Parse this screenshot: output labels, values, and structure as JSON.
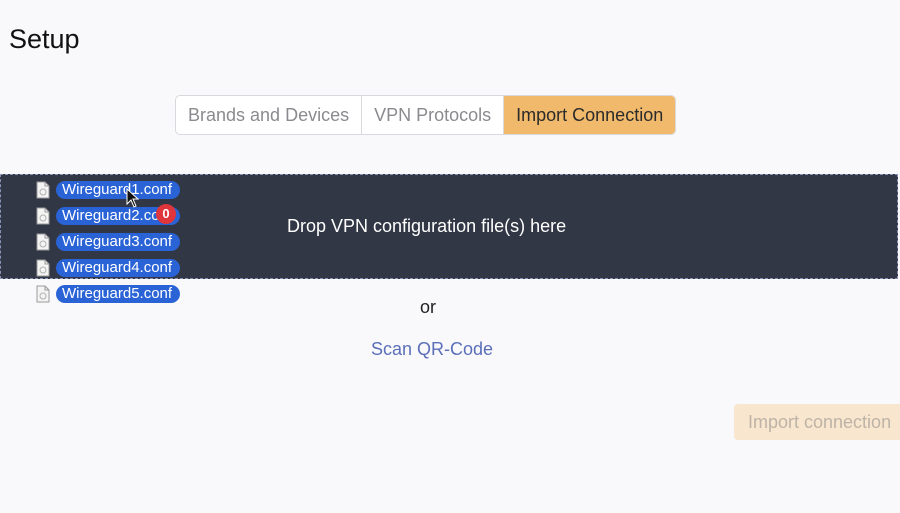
{
  "page": {
    "title": "Setup"
  },
  "tabs": [
    {
      "label": "Brands and Devices",
      "active": false
    },
    {
      "label": "VPN Protocols",
      "active": false
    },
    {
      "label": "Import Connection",
      "active": true
    }
  ],
  "drop_zone": {
    "text": "Drop VPN configuration file(s) here"
  },
  "dragged_files": [
    {
      "name": "Wireguard1.conf",
      "icon": "document-icon"
    },
    {
      "name": "Wireguard2.conf",
      "icon": "document-icon"
    },
    {
      "name": "Wireguard3.conf",
      "icon": "document-icon"
    },
    {
      "name": "Wireguard4.conf",
      "icon": "document-icon"
    },
    {
      "name": "Wireguard5.conf",
      "icon": "document-icon"
    }
  ],
  "drag_badge": {
    "count": "0"
  },
  "alternatives": {
    "or_text": "or",
    "scan_qr_label": "Scan QR-Code"
  },
  "actions": {
    "import_label": "Import connection"
  },
  "colors": {
    "accent": "#f0b96b",
    "drop_zone_bg": "#313744",
    "file_pill": "#2a63d6",
    "badge": "#e0353b",
    "link": "#5a6fb8",
    "import_disabled_bg": "#f9e6cf"
  }
}
